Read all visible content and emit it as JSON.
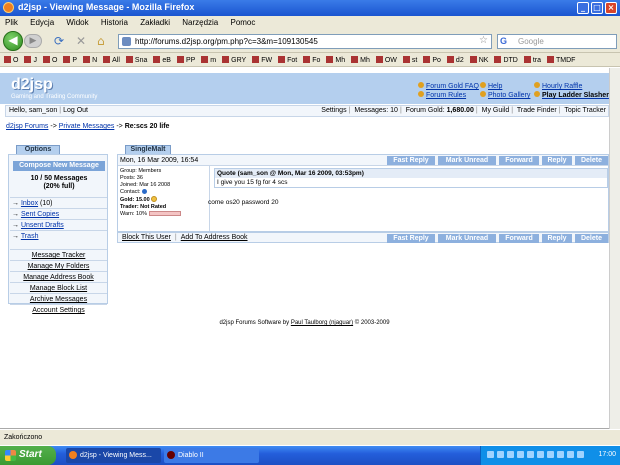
{
  "window": {
    "title": "d2jsp - Viewing Message - Mozilla Firefox",
    "controls": [
      "_",
      "□",
      "×"
    ]
  },
  "menu": [
    "Plik",
    "Edycja",
    "Widok",
    "Historia",
    "Zakładki",
    "Narzędzia",
    "Pomoc"
  ],
  "nav": {
    "url": "http://forums.d2jsp.org/pm.php?c=3&m=109130545",
    "search_placeholder": "Google"
  },
  "bookmarks": [
    "O",
    "J",
    "O",
    "P",
    "N",
    "All",
    "Sna",
    "eB",
    "PP",
    "m",
    "GRY",
    "FW",
    "Fot",
    "Fo",
    "Mh",
    "Mh",
    "OW",
    "st",
    "Po",
    "d2",
    "NK",
    "DTD",
    "tra",
    "TMDF"
  ],
  "site": {
    "logo": "d2jsp",
    "tagline": "Gaming and Trading Community",
    "header_links": {
      "gold_faq": "Forum Gold FAQ",
      "help": "Help",
      "raffle": "Hourly Raffle",
      "rules": "Forum Rules",
      "gallery": "Photo Gallery",
      "ladder": "Play Ladder Slasher"
    }
  },
  "userbar": {
    "greeting": "Hello, sam_son",
    "logout": "Log Out",
    "settings": "Settings",
    "messages": "Messages: 10",
    "gold_label": "Forum Gold:",
    "gold_value": "1,680.00",
    "guild": "My Guild",
    "trade_finder": "Trade Finder",
    "topic_tracker": "Topic Tracker"
  },
  "breadcrumb": {
    "forums": "d2jsp Forums",
    "sep1": "->",
    "pm": "Private Messages",
    "sep2": "->",
    "subject": "Re:scs 20 life"
  },
  "sidebar": {
    "header": "Options",
    "compose": "Compose New Message",
    "count_line1": "10 / 50 Messages",
    "count_line2": "(20% full)",
    "folders": [
      {
        "arrow": "→",
        "label": "Inbox",
        "count": "(10)"
      },
      {
        "arrow": "→",
        "label": "Sent Copies",
        "count": ""
      },
      {
        "arrow": "→",
        "label": "Unsent Drafts",
        "count": ""
      },
      {
        "arrow": "→",
        "label": "Trash",
        "count": ""
      }
    ],
    "tools": [
      "Message Tracker",
      "Manage My Folders",
      "Manage Address Book",
      "Manage Block List",
      "Archive Messages",
      "Account Settings"
    ]
  },
  "message": {
    "author": "SingleMalt",
    "date": "Mon, 16 Mar 2009, 16:54",
    "actions": [
      "Fast Reply",
      "Mark Unread",
      "Forward",
      "Reply",
      "Delete"
    ],
    "user": {
      "group": "Group: Members",
      "posts": "Posts: 36",
      "joined": "Joined: Mar 16 2008",
      "contact": "Contact:",
      "gold_label": "Gold:",
      "gold_value": "15.00",
      "trader": "Trader: Not Rated",
      "warn": "Warn: 10%"
    },
    "quote_header": "Quote (sam_son @ Mon, Mar 16 2009, 03:53pm)",
    "quote_text": "I give you 15 fg for 4 scs",
    "body": "come os20 password 20",
    "block_user": "Block This User",
    "add_address": "Add To Address Book",
    "bottom_sep": "|"
  },
  "footer": {
    "prefix": "d2jsp Forums Software by",
    "author": "Paul Taulborg (njaguar)",
    "suffix": "© 2003-2009"
  },
  "statusbar": "Zakończono",
  "taskbar": {
    "start": "Start",
    "tasks": [
      "d2jsp - Viewing Mess...",
      "Diablo II"
    ],
    "clock": "17:00"
  }
}
